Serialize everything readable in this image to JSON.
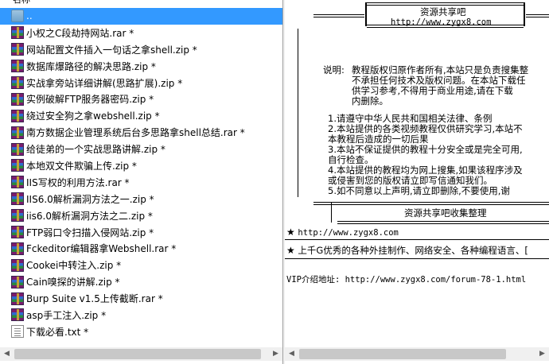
{
  "left_pane": {
    "header": "名称",
    "items": [
      {
        "name": "..",
        "icon": "folder-up-icon",
        "selected": true
      },
      {
        "name": "小权之C段劫持网站.rar *",
        "icon": "rar-archive-icon"
      },
      {
        "name": "网站配置文件插入一句话之拿shell.zip *",
        "icon": "rar-archive-icon"
      },
      {
        "name": "数据库爆路径的解决思路.zip *",
        "icon": "rar-archive-icon"
      },
      {
        "name": "实战拿旁站详细讲解(思路扩展).zip *",
        "icon": "rar-archive-icon"
      },
      {
        "name": "实例破解FTP服务器密码.zip *",
        "icon": "rar-archive-icon"
      },
      {
        "name": "绕过安全狗之拿webshell.zip *",
        "icon": "rar-archive-icon"
      },
      {
        "name": "南方数据企业管理系统后台多思路拿shell总结.rar *",
        "icon": "rar-archive-icon"
      },
      {
        "name": "给徒弟的一个实战思路讲解.zip *",
        "icon": "rar-archive-icon"
      },
      {
        "name": "本地双文件欺骗上传.zip *",
        "icon": "rar-archive-icon"
      },
      {
        "name": "IIS写权的利用方法.rar *",
        "icon": "rar-archive-icon"
      },
      {
        "name": "IIS6.0解析漏洞方法之一.zip *",
        "icon": "rar-archive-icon"
      },
      {
        "name": "iis6.0解析漏洞方法之二.zip *",
        "icon": "rar-archive-icon"
      },
      {
        "name": "FTP弱口令扫描入侵网站.zip *",
        "icon": "rar-archive-icon"
      },
      {
        "name": "Fckeditor编辑器拿Webshell.rar *",
        "icon": "rar-archive-icon"
      },
      {
        "name": "Cookei中转注入.zip *",
        "icon": "rar-archive-icon"
      },
      {
        "name": "Cain嗅探的讲解.zip *",
        "icon": "rar-archive-icon"
      },
      {
        "name": "Burp Suite v1.5上传截断.rar *",
        "icon": "rar-archive-icon"
      },
      {
        "name": "asp手工注入.zip *",
        "icon": "rar-archive-icon"
      },
      {
        "name": "下载必看.txt *",
        "icon": "text-file-icon"
      }
    ]
  },
  "right_pane": {
    "box_title": "资源共享吧",
    "box_url": "http://www.zygx8.com",
    "notice_label": "说明:",
    "notice_lines": [
      "教程版权归原作者所有,本站只是负责搜集整",
      "不承担任何技术及版权问题。在本站下载任",
      "供学习参考,不得用于商业用途,请在下载",
      "内删除。"
    ],
    "rules": [
      "1.请遵守中华人民共和国相关法律、条例",
      "2.本站提供的各类视频教程仅供研究学习,本站不",
      "  本教程后造成的一切后果",
      "3.本站不保证提供的教程十分安全或是完全可用,",
      "  自行检查。",
      "4.本站提供的教程均为网上搜集,如果该程序涉及",
      "  或侵害到您的版权请立即写信通知我们。",
      "5.如不同意以上声明,请立即删除,不要使用,谢"
    ],
    "footer_title": "资源共享吧收集整理",
    "star_url": "http://www.zygx8.com",
    "star_desc": "上千G优秀的各种外挂制作、网络安全、各种编程语言、[",
    "vip": "VIP介绍地址: http://www.zygx8.com/forum-78-1.html"
  },
  "colors": {
    "selection": "#3399ff",
    "pane_bg": "#ffffff",
    "chrome": "#f0f0f0"
  }
}
